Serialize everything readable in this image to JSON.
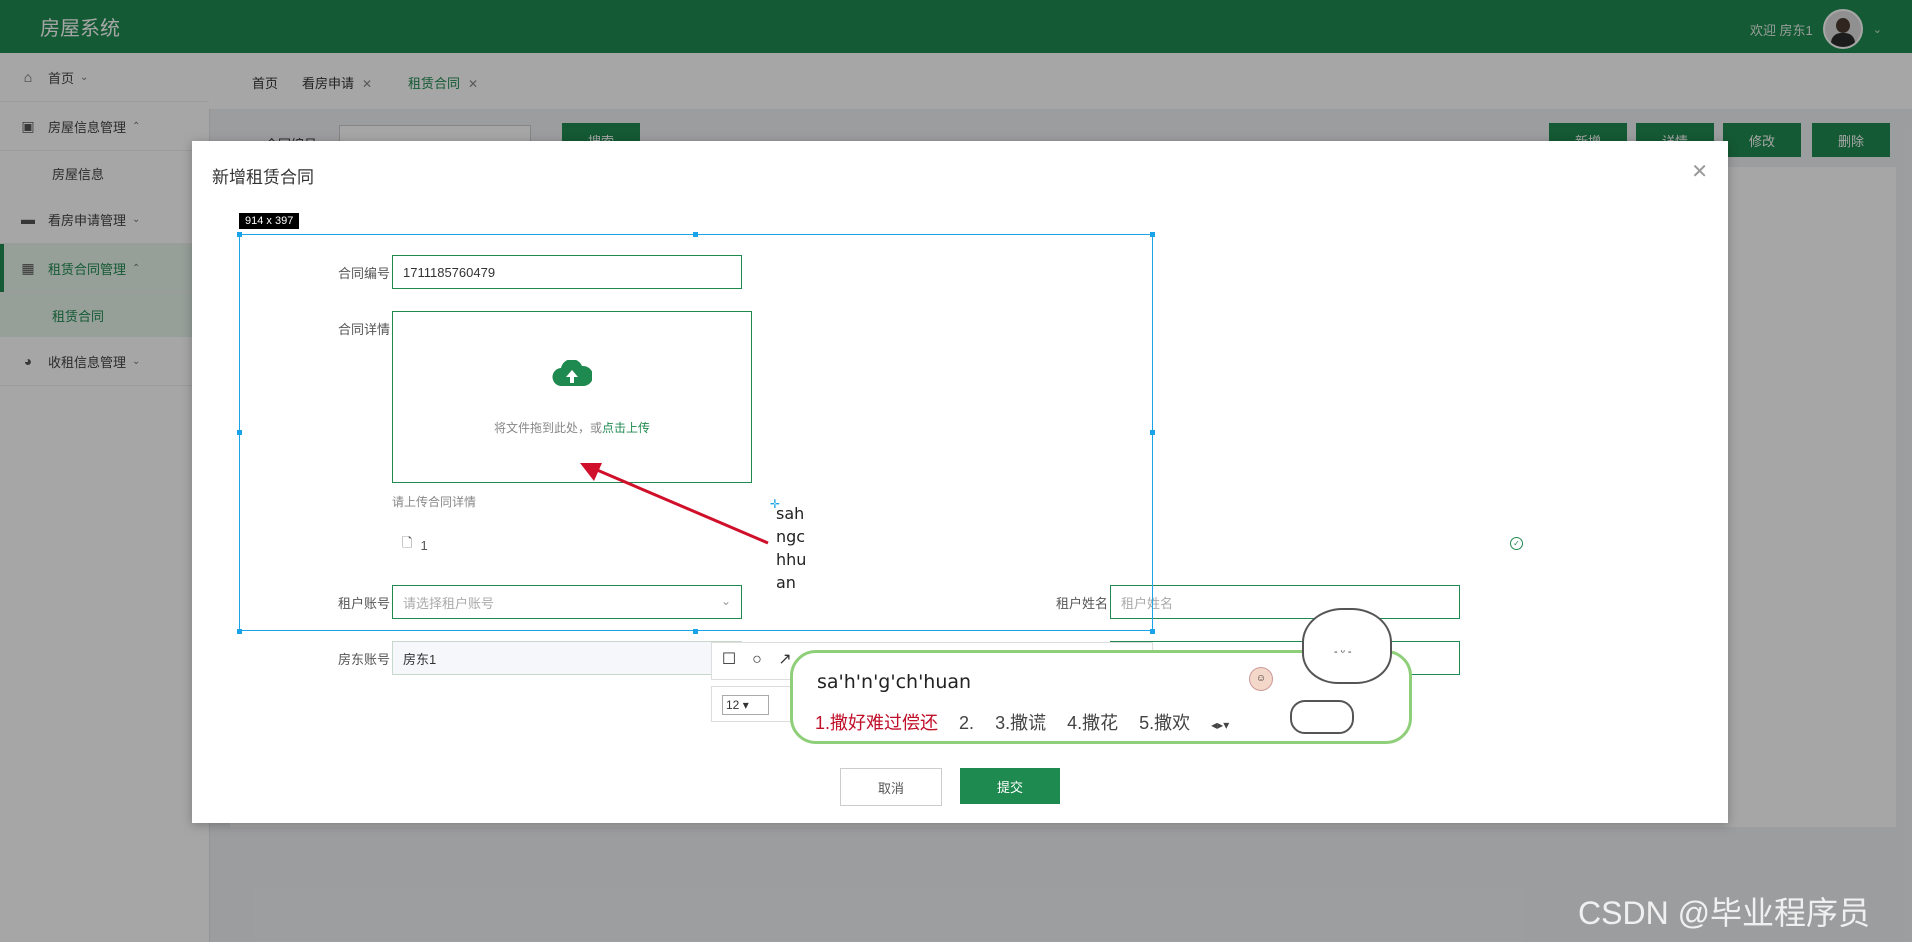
{
  "header": {
    "brand": "房屋系统",
    "welcome": "欢迎 房东1"
  },
  "sidebar": {
    "items": [
      {
        "label": "首页"
      },
      {
        "label": "房屋信息管理",
        "sub": "房屋信息"
      },
      {
        "label": "看房申请管理"
      },
      {
        "label": "租赁合同管理",
        "sub": "租赁合同"
      },
      {
        "label": "收租信息管理"
      }
    ]
  },
  "tabs": [
    {
      "label": "首页"
    },
    {
      "label": "看房申请"
    },
    {
      "label": "租赁合同"
    }
  ],
  "search": {
    "label": "合同编号",
    "placeholder": "合同编号",
    "button": "搜索"
  },
  "actions": {
    "add": "新增",
    "detail": "详情",
    "edit": "修改",
    "delete": "删除"
  },
  "dialog": {
    "title": "新增租赁合同",
    "contract_no_label": "合同编号",
    "contract_no_value": "1711185760479",
    "contract_detail_label": "合同详情",
    "upload_text": "将文件拖到此处，或",
    "upload_link": "点击上传",
    "upload_tip": "请上传合同详情",
    "file_name": "1",
    "tenant_account_label": "租户账号",
    "tenant_account_placeholder": "请选择租户账号",
    "tenant_name_label": "租户姓名",
    "tenant_name_placeholder": "租户姓名",
    "landlord_account_label": "房东账号",
    "landlord_account_value": "房东1",
    "cancel": "取消",
    "submit": "提交"
  },
  "screenshot_tool": {
    "size_label": "914 x 397",
    "preedit_text": "sah\nngc\nhhu\nan",
    "font_size": "12"
  },
  "ime": {
    "input": "sa'h'n'g'ch'huan",
    "candidates": [
      "1.撒好难过偿还",
      "2.",
      "3.撒谎",
      "4.撒花",
      "5.撒欢"
    ]
  },
  "watermark": "CSDN @毕业程序员",
  "colors": {
    "primary": "#1f8a50",
    "selection": "#1aa3e8",
    "ime_border": "#8fcf7a",
    "candidate": "#c0102a"
  }
}
